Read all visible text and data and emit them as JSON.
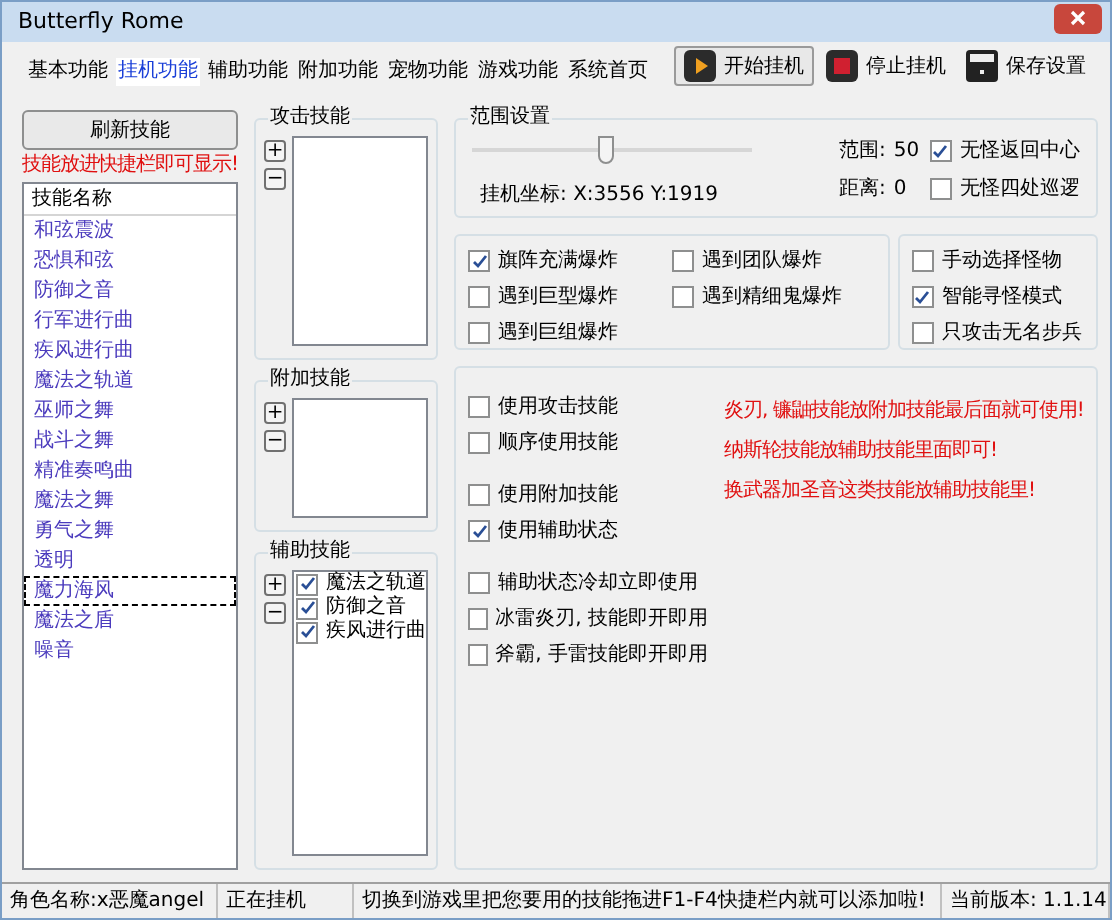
{
  "window": {
    "title": "Butterfly Rome"
  },
  "tabs": [
    {
      "label": "基本功能",
      "selected": false
    },
    {
      "label": "挂机功能",
      "selected": true
    },
    {
      "label": "辅助功能",
      "selected": false
    },
    {
      "label": "附加功能",
      "selected": false
    },
    {
      "label": "宠物功能",
      "selected": false
    },
    {
      "label": "游戏功能",
      "selected": false
    },
    {
      "label": "系统首页",
      "selected": false
    }
  ],
  "toolbar": [
    {
      "kind": "start",
      "label": "开始挂机"
    },
    {
      "kind": "stop",
      "label": "停止挂机"
    },
    {
      "kind": "save",
      "label": "保存设置"
    }
  ],
  "skills_panel": {
    "refresh_button": "刷新技能",
    "hint": "技能放进快捷栏即可显示!",
    "column": "技能名称",
    "items": [
      {
        "label": "和弦震波",
        "selected": false
      },
      {
        "label": "恐惧和弦",
        "selected": false
      },
      {
        "label": "防御之音",
        "selected": false
      },
      {
        "label": "行军进行曲",
        "selected": false
      },
      {
        "label": "疾风进行曲",
        "selected": false
      },
      {
        "label": "魔法之轨道",
        "selected": false
      },
      {
        "label": "巫师之舞",
        "selected": false
      },
      {
        "label": "战斗之舞",
        "selected": false
      },
      {
        "label": "精准奏鸣曲",
        "selected": false
      },
      {
        "label": "魔法之舞",
        "selected": false
      },
      {
        "label": "勇气之舞",
        "selected": false
      },
      {
        "label": "透明",
        "selected": false
      },
      {
        "label": "魔力海风",
        "selected": true
      },
      {
        "label": "魔法之盾",
        "selected": false
      },
      {
        "label": "噪音",
        "selected": false
      }
    ]
  },
  "skill_groups": [
    {
      "title": "攻击技能",
      "add": "+",
      "remove": "−"
    },
    {
      "title": "附加技能",
      "add": "+",
      "remove": "−"
    },
    {
      "title": "辅助技能",
      "add": "+",
      "remove": "−",
      "items": [
        {
          "label": "魔法之轨道",
          "checked": true
        },
        {
          "label": "防御之音",
          "checked": true
        },
        {
          "label": "疾风进行曲",
          "checked": true
        }
      ]
    }
  ],
  "range_settings": {
    "title": "范围设置",
    "slider": {
      "level": 0.48
    },
    "coords": "挂机坐标: X:3556 Y:1919",
    "range_label": "范围:",
    "range_value": "50",
    "distance_label": "距离:",
    "distance_value": "0",
    "options": [
      {
        "label": "无怪返回中心",
        "checked": true
      },
      {
        "label": "无怪四处巡逻",
        "checked": false
      }
    ]
  },
  "explode_options": [
    {
      "label": "旗阵充满爆炸",
      "checked": true
    },
    {
      "label": "遇到团队爆炸",
      "checked": false
    },
    {
      "label": "遇到巨型爆炸",
      "checked": false
    },
    {
      "label": "遇到精细鬼爆炸",
      "checked": false
    },
    {
      "label": "遇到巨组爆炸",
      "checked": false
    }
  ],
  "target_options": [
    {
      "label": "手动选择怪物",
      "checked": false
    },
    {
      "label": "智能寻怪模式",
      "checked": true
    },
    {
      "label": "只攻击无名步兵",
      "checked": false
    }
  ],
  "skill_options": [
    {
      "label": "使用攻击技能",
      "checked": false
    },
    {
      "label": "顺序使用技能",
      "checked": false
    },
    {
      "label": "使用附加技能",
      "checked": false
    },
    {
      "label": "使用辅助状态",
      "checked": true
    },
    {
      "label": "辅助状态冷却立即使用",
      "checked": false
    },
    {
      "label": "冰雷炎刃, 技能即开即用",
      "checked": false
    },
    {
      "label": "斧霸, 手雷技能即开即用",
      "checked": false
    }
  ],
  "notes": [
    "炎刃, 镰鼬技能放附加技能最后面就可使用!",
    "纳斯轮技能放辅助技能里面即可!",
    "换武器加圣音这类技能放辅助技能里!"
  ],
  "status_bar": [
    "角色名称:x恶魔angel",
    "正在挂机",
    "切换到游戏里把您要用的技能拖进F1-F4快捷栏内就可以添加啦!",
    "当前版本: 1.1.14"
  ]
}
